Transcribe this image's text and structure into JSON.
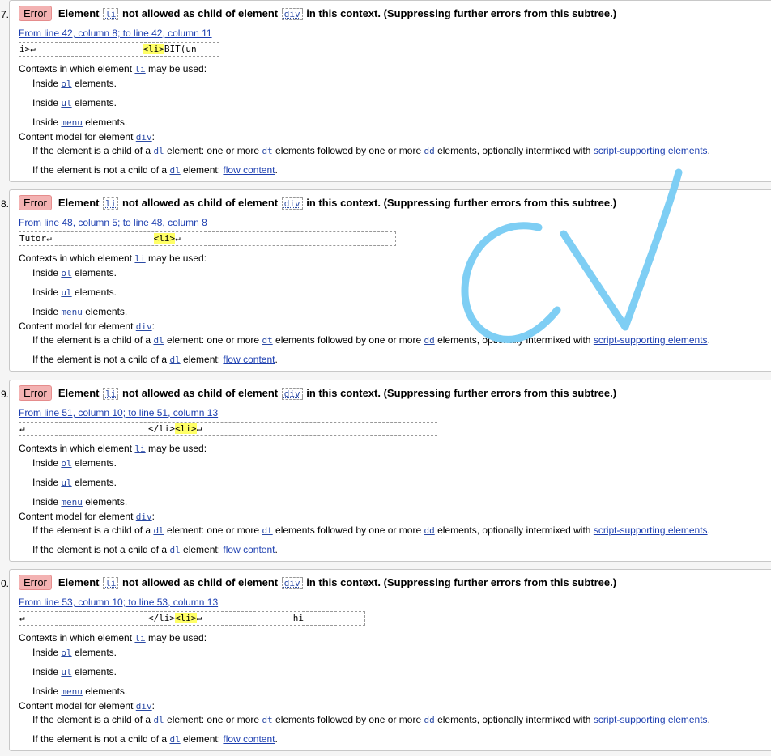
{
  "strings": {
    "error_badge": "Error",
    "element": "Element",
    "li": "li",
    "not_allowed": "not allowed as child of element",
    "div": "div",
    "context_tail": "in this context. (Suppressing further errors from this subtree.)",
    "contexts_pre": "Contexts in which element",
    "contexts_post": "may be used:",
    "inside": "Inside",
    "elements": "elements.",
    "ol": "ol",
    "ul": "ul",
    "menu": "menu",
    "content_model": "Content model for element",
    "colon": ":",
    "cond1_pre": "If the element is a child of a",
    "dl": "dl",
    "cond1_mid1": "element: one or more",
    "dt": "dt",
    "cond1_mid2": "elements followed by one or more",
    "dd": "dd",
    "cond1_mid3": "elements, optionally intermixed with",
    "script_supporting": "script-supporting elements",
    "period": ".",
    "cond2_pre": "If the element is not a child of a",
    "cond2_mid": "element:",
    "flow_content": "flow content"
  },
  "errors": [
    {
      "num": "7.",
      "location": "From line 42, column 8; to line 42, column 11",
      "extract_before": "i>↵                    ",
      "extract_hl": "<li>",
      "extract_after": "BIT(un"
    },
    {
      "num": "8.",
      "location": "From line 48, column 5; to line 48, column 8",
      "extract_before": "Tutor↵                   ",
      "extract_hl": "<li>",
      "extract_after": "↵"
    },
    {
      "num": "9.",
      "location": "From line 51, column 10; to line 51, column 13",
      "extract_before": "↵                       </li>",
      "extract_hl": "<li>",
      "extract_after": "↵"
    },
    {
      "num": "0.",
      "location": "From line 53, column 10; to line 53, column 13",
      "extract_before": "↵                       </li>",
      "extract_hl": "<li>",
      "extract_after": "↵                 hi"
    }
  ],
  "overlay": {
    "glyph_text": "CV",
    "color": "#7ecef4"
  }
}
